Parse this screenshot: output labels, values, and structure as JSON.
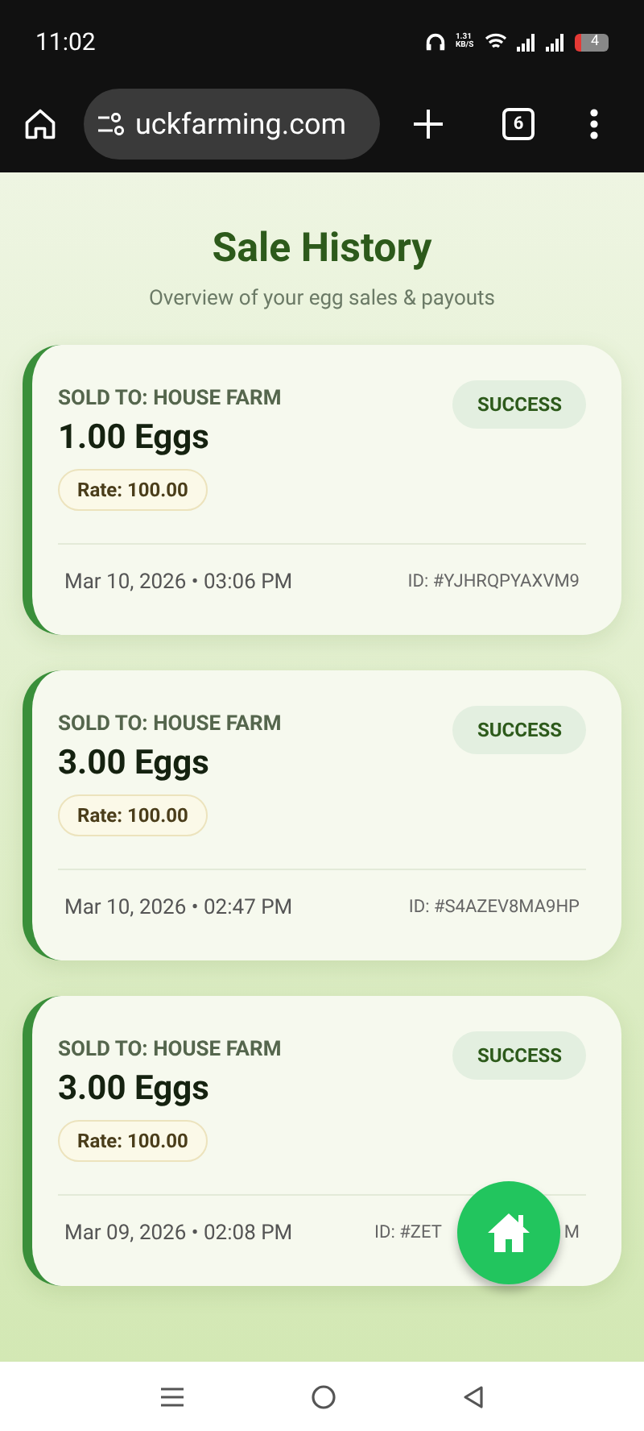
{
  "status_bar": {
    "time": "11:02",
    "speed": "1.31 KB/S",
    "battery": "4"
  },
  "browser": {
    "url": "uckfarming.com",
    "tab_count": "6"
  },
  "page": {
    "title": "Sale History",
    "subtitle": "Overview of your egg sales & payouts"
  },
  "sales": [
    {
      "sold_to": "SOLD TO: HOUSE FARM",
      "amount": "1.00 Eggs",
      "rate": "Rate: 100.00",
      "status": "SUCCESS",
      "date": "Mar 10, 2026 • 03:06 PM",
      "id": "ID: #YJHRQPYAXVM9"
    },
    {
      "sold_to": "SOLD TO: HOUSE FARM",
      "amount": "3.00 Eggs",
      "rate": "Rate: 100.00",
      "status": "SUCCESS",
      "date": "Mar 10, 2026 • 02:47 PM",
      "id": "ID: #S4AZEV8MA9HP"
    },
    {
      "sold_to": "SOLD TO: HOUSE FARM",
      "amount": "3.00 Eggs",
      "rate": "Rate: 100.00",
      "status": "SUCCESS",
      "date": "Mar 09, 2026 • 02:08 PM",
      "id": "ID: #ZET",
      "id_end": "M"
    }
  ]
}
